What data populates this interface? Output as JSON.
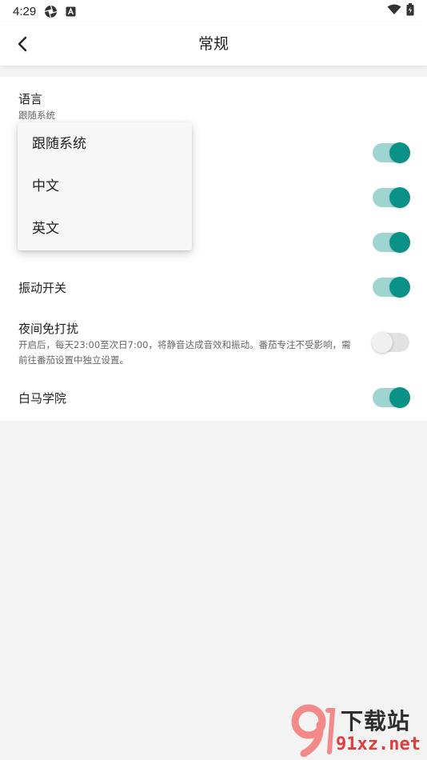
{
  "status_bar": {
    "time": "4:29",
    "icons": [
      "settings-aperture-icon",
      "a-box-icon",
      "wifi-icon",
      "battery-icon"
    ]
  },
  "app_bar": {
    "back_icon": "chevron-left-icon",
    "title": "常规"
  },
  "settings": {
    "language": {
      "label": "语言",
      "value": "跟随系统"
    },
    "vibration": {
      "label": "振动开关",
      "enabled": true
    },
    "night_dnd": {
      "label": "夜间免打扰",
      "description": "开启后，每天23:00至次日7:00，将静音达成音效和振动。番茄专注不受影响，需前往番茄设置中独立设置。",
      "enabled": false
    },
    "academy": {
      "label": "白马学院",
      "enabled": true
    },
    "hidden_switches": [
      {
        "enabled": true
      },
      {
        "enabled": true
      },
      {
        "enabled": true
      }
    ]
  },
  "language_menu": {
    "options": [
      "跟随系统",
      "中文",
      "英文"
    ]
  },
  "watermark": {
    "line1": "下载站",
    "line2": "91xz.net"
  },
  "colors": {
    "accent": "#0a9188",
    "accent_track": "#9fd5d1",
    "background": "#f3f3f3",
    "surface": "#ffffff"
  }
}
